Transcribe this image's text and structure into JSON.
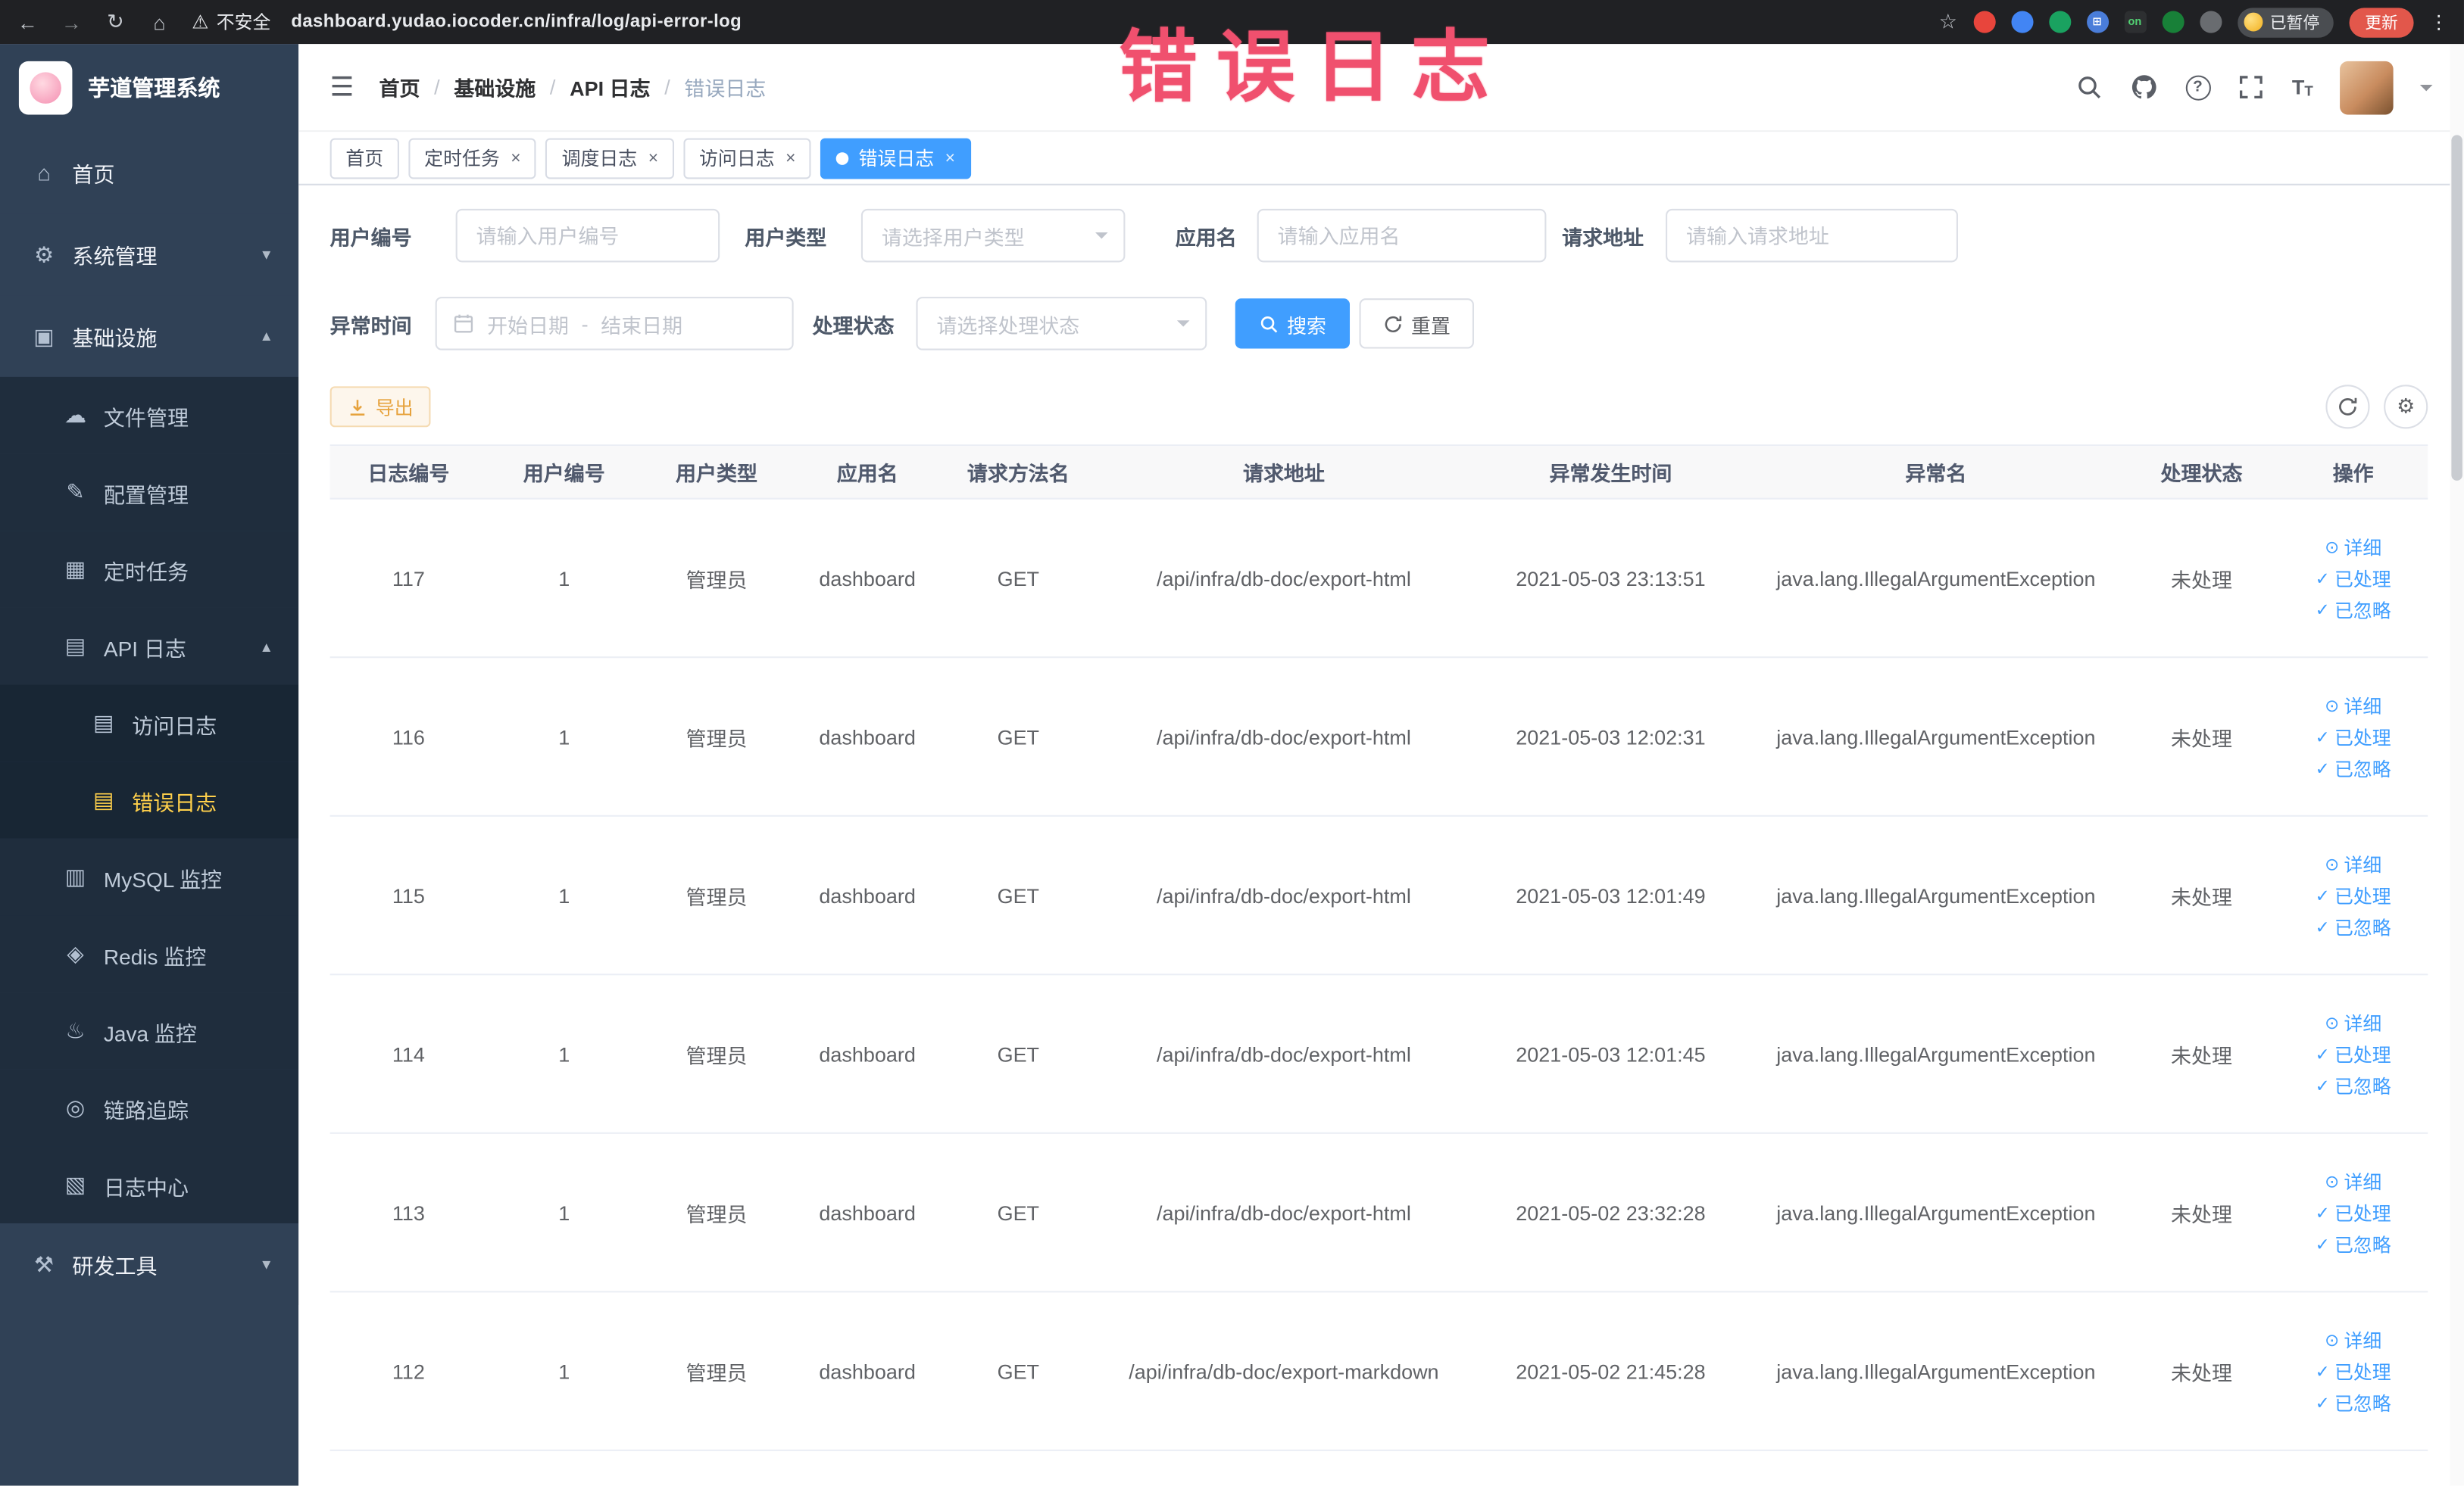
{
  "browser": {
    "security_label": "不安全",
    "url": "dashboard.yudao.iocoder.cn/infra/log/api-error-log",
    "paused_badge": "已暂停",
    "update_button": "更新",
    "extensions": [
      {
        "name": "extension-red-icon",
        "color": "#e8453c",
        "text": "",
        "text_color": "#fff"
      },
      {
        "name": "extension-blue-icon",
        "color": "#4285f4",
        "text": "",
        "text_color": "#fff"
      },
      {
        "name": "extension-green-icon",
        "color": "#1aa260",
        "text": "",
        "text_color": "#fff"
      },
      {
        "name": "extension-grid-icon",
        "color": "#4a7dd9",
        "text": "⊞",
        "text_color": "#fff"
      },
      {
        "name": "extension-on-icon",
        "color": "#2d2f31",
        "text": "on",
        "text_color": "#52d273"
      },
      {
        "name": "extension-leaf-icon",
        "color": "#188038",
        "text": "",
        "text_color": "#fff"
      },
      {
        "name": "extension-puzzle-icon",
        "color": "#696c70",
        "text": "",
        "text_color": "#fff"
      }
    ]
  },
  "annotation": {
    "text": "错误日志",
    "color": "#f0506e"
  },
  "sidebar": {
    "logo_title": "芋道管理系统",
    "items": [
      {
        "name": "home",
        "label": "首页",
        "level": 1,
        "glyph": "⌂",
        "icon": "home-icon"
      },
      {
        "name": "system-management",
        "label": "系统管理",
        "level": 1,
        "glyph": "⚙",
        "icon": "gear-icon",
        "chevron": "down"
      },
      {
        "name": "infrastructure",
        "label": "基础设施",
        "level": 1,
        "glyph": "▣",
        "icon": "infrastructure-icon",
        "chevron": "up"
      },
      {
        "name": "file-management",
        "label": "文件管理",
        "level": 2,
        "glyph": "☁",
        "icon": "file-icon"
      },
      {
        "name": "config-management",
        "label": "配置管理",
        "level": 2,
        "glyph": "✎",
        "icon": "config-icon"
      },
      {
        "name": "scheduled-tasks",
        "label": "定时任务",
        "level": 2,
        "glyph": "▦",
        "icon": "task-icon"
      },
      {
        "name": "api-log",
        "label": "API 日志",
        "level": 2,
        "glyph": "▤",
        "icon": "api-log-icon",
        "chevron": "up"
      },
      {
        "name": "access-log",
        "label": "访问日志",
        "level": 3,
        "glyph": "▤",
        "icon": "access-log-icon"
      },
      {
        "name": "error-log",
        "label": "错误日志",
        "level": 3,
        "glyph": "▤",
        "icon": "error-log-icon",
        "active": true
      },
      {
        "name": "mysql-monitor",
        "label": "MySQL 监控",
        "level": 2,
        "glyph": "▥",
        "icon": "mysql-icon"
      },
      {
        "name": "redis-monitor",
        "label": "Redis 监控",
        "level": 2,
        "glyph": "◈",
        "icon": "redis-icon"
      },
      {
        "name": "java-monitor",
        "label": "Java 监控",
        "level": 2,
        "glyph": "♨",
        "icon": "java-icon"
      },
      {
        "name": "trace",
        "label": "链路追踪",
        "level": 2,
        "glyph": "◎",
        "icon": "trace-icon"
      },
      {
        "name": "log-center",
        "label": "日志中心",
        "level": 2,
        "glyph": "▧",
        "icon": "log-center-icon"
      },
      {
        "name": "dev-tools",
        "label": "研发工具",
        "level": 1,
        "glyph": "⚒",
        "icon": "tools-icon",
        "chevron": "down"
      }
    ]
  },
  "header": {
    "breadcrumb": [
      "首页",
      "基础设施",
      "API 日志",
      "错误日志"
    ]
  },
  "tabs": [
    {
      "name": "tab-home",
      "label": "首页",
      "closable": false,
      "active": false
    },
    {
      "name": "tab-scheduled-tasks",
      "label": "定时任务",
      "closable": true,
      "active": false
    },
    {
      "name": "tab-schedule-log",
      "label": "调度日志",
      "closable": true,
      "active": false
    },
    {
      "name": "tab-access-log",
      "label": "访问日志",
      "closable": true,
      "active": false
    },
    {
      "name": "tab-error-log",
      "label": "错误日志",
      "closable": true,
      "active": true
    }
  ],
  "filters": {
    "user_id": {
      "label": "用户编号",
      "placeholder": "请输入用户编号"
    },
    "user_type": {
      "label": "用户类型",
      "placeholder": "请选择用户类型"
    },
    "app_name": {
      "label": "应用名",
      "placeholder": "请输入应用名"
    },
    "request_url": {
      "label": "请求地址",
      "placeholder": "请输入请求地址"
    },
    "exception_time": {
      "label": "异常时间",
      "start_placeholder": "开始日期",
      "separator": "-",
      "end_placeholder": "结束日期"
    },
    "process_status": {
      "label": "处理状态",
      "placeholder": "请选择处理状态"
    },
    "search_label": "搜索",
    "reset_label": "重置"
  },
  "toolbar": {
    "export_label": "导出"
  },
  "table": {
    "headers": [
      "日志编号",
      "用户编号",
      "用户类型",
      "应用名",
      "请求方法名",
      "请求地址",
      "异常发生时间",
      "异常名",
      "处理状态",
      "操作"
    ],
    "actions": [
      {
        "name": "action-detail",
        "label": "详细",
        "glyph": "⊙"
      },
      {
        "name": "action-processed",
        "label": "已处理",
        "glyph": "✓"
      },
      {
        "name": "action-ignored",
        "label": "已忽略",
        "glyph": "✓"
      }
    ],
    "rows": [
      {
        "log_id": "117",
        "user_id": "1",
        "user_type": "管理员",
        "app_name": "dashboard",
        "method": "GET",
        "url": "/api/infra/db-doc/export-html",
        "time": "2021-05-03 23:13:51",
        "exception": "java.lang.IllegalArgumentException",
        "status": "未处理"
      },
      {
        "log_id": "116",
        "user_id": "1",
        "user_type": "管理员",
        "app_name": "dashboard",
        "method": "GET",
        "url": "/api/infra/db-doc/export-html",
        "time": "2021-05-03 12:02:31",
        "exception": "java.lang.IllegalArgumentException",
        "status": "未处理"
      },
      {
        "log_id": "115",
        "user_id": "1",
        "user_type": "管理员",
        "app_name": "dashboard",
        "method": "GET",
        "url": "/api/infra/db-doc/export-html",
        "time": "2021-05-03 12:01:49",
        "exception": "java.lang.IllegalArgumentException",
        "status": "未处理"
      },
      {
        "log_id": "114",
        "user_id": "1",
        "user_type": "管理员",
        "app_name": "dashboard",
        "method": "GET",
        "url": "/api/infra/db-doc/export-html",
        "time": "2021-05-03 12:01:45",
        "exception": "java.lang.IllegalArgumentException",
        "status": "未处理"
      },
      {
        "log_id": "113",
        "user_id": "1",
        "user_type": "管理员",
        "app_name": "dashboard",
        "method": "GET",
        "url": "/api/infra/db-doc/export-html",
        "time": "2021-05-02 23:32:28",
        "exception": "java.lang.IllegalArgumentException",
        "status": "未处理"
      },
      {
        "log_id": "112",
        "user_id": "1",
        "user_type": "管理员",
        "app_name": "dashboard",
        "method": "GET",
        "url": "/api/infra/db-doc/export-markdown",
        "time": "2021-05-02 21:45:28",
        "exception": "java.lang.IllegalArgumentException",
        "status": "未处理"
      }
    ]
  }
}
